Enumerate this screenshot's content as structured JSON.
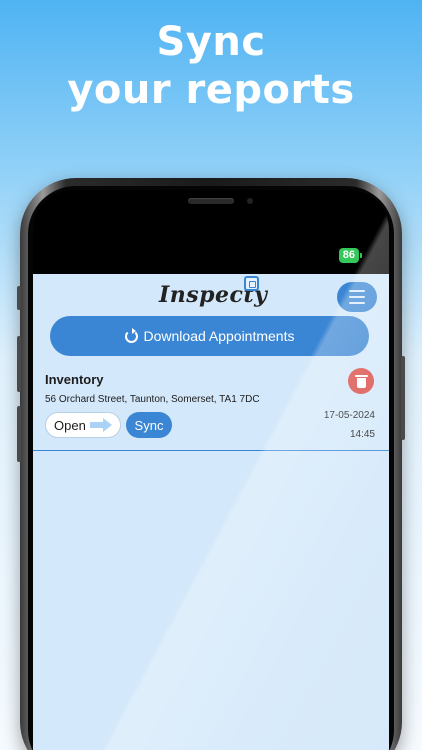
{
  "promo": {
    "line1": "Sync",
    "line2": "your reports"
  },
  "status_bar": {
    "battery": "86"
  },
  "header": {
    "logo_text": "Inspecty"
  },
  "toolbar": {
    "download_label": "Download Appointments"
  },
  "appointment": {
    "title": "Inventory",
    "address": "56 Orchard Street, Taunton, Somerset, TA1 7DC",
    "open_label": "Open",
    "sync_label": "Sync",
    "date": "17-05-2024",
    "time": "14:45"
  },
  "colors": {
    "primary": "#3a86d4",
    "delete": "#d94a45",
    "app_background": "#d3e8fa"
  },
  "icons": [
    "refresh-icon",
    "menu-icon",
    "trash-icon",
    "arrow-right-icon"
  ]
}
